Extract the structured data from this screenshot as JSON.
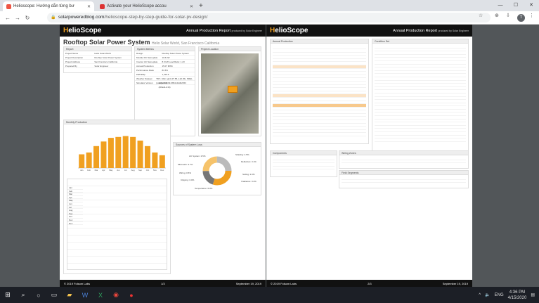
{
  "tabs": [
    {
      "title": "Helioscope: Hướng dẫn từng bư",
      "active": true
    },
    {
      "title": "Activate your HelioScope accou",
      "active": false
    }
  ],
  "address": {
    "domain": "solarpoweredblog.com",
    "path": "/helioscope-step-by-step-guide-for-solar-pv-design/"
  },
  "avatar": "T",
  "report": {
    "logo_a": "H",
    "logo_b": "elioScope",
    "title": "Annual Production Report",
    "subtitle": "produced by Solar Engineer",
    "main_title": "Rooftop Solar Power System",
    "location": "Helio Solar World, San Francisco California",
    "footer_left": "© 2019 Folsom Labs",
    "page1": "1/3",
    "page2": "2/3",
    "footer_date": "September 19, 2019",
    "sections": {
      "report": "Report",
      "metrics": "System Metrics",
      "location": "Project Location",
      "monthly": "Monthly Production",
      "sources": "Sources of System Loss",
      "annual": "Annual Production",
      "condition": "Condition Set",
      "components": "Components",
      "wiring": "Wiring Zones",
      "segments": "Field Segments"
    },
    "report_rows": [
      [
        "Project Name",
        "Hello Solar World"
      ],
      [
        "Project Description",
        "Rooftop Solar Power System"
      ],
      [
        "Project Address",
        "San Francisco California"
      ],
      [
        "Prepared By",
        "Solar Engineer"
      ]
    ],
    "metric_rows": [
      [
        "Design",
        "Rooftop Solar Power System"
      ],
      [
        "Module DC Nameplate",
        "10.6 kW"
      ],
      [
        "Inverter AC Nameplate",
        "8.6 kW Load Ratio: 1.23"
      ],
      [
        "Annual Production",
        "15.07 MWh"
      ],
      [
        "Performance Ratio",
        "81.5%"
      ],
      [
        "kWh/kWp",
        "1,419.6"
      ],
      [
        "Weather Dataset",
        "TMY, 10km grid (37.85,-122.45), NREL (prospector)"
      ],
      [
        "Simulator Version",
        "a57e0b9b09-9864c4ddb2b53 (t06a11-b16)"
      ]
    ],
    "months": [
      "Jan",
      "Feb",
      "Mar",
      "Apr",
      "May",
      "Jun",
      "Jul",
      "Aug",
      "Sep",
      "Oct",
      "Nov",
      "Dec"
    ],
    "loss_labels": [
      "AC System: 2.5%",
      "Shading: 4.5%",
      "Reflection: 3.1%",
      "Soiling: 2.0%",
      "Irradiance: 0.2%",
      "Mismatch: 3.7%",
      "Wiring: 0.5%",
      "Clipping: 0.0%",
      "Temperature: 6.0%"
    ]
  },
  "chart_data": {
    "type": "bar",
    "categories": [
      "Jan",
      "Feb",
      "Mar",
      "Apr",
      "May",
      "Jun",
      "Jul",
      "Aug",
      "Sep",
      "Oct",
      "Nov",
      "Dec"
    ],
    "values": [
      750,
      850,
      1200,
      1450,
      1650,
      1700,
      1750,
      1700,
      1500,
      1200,
      850,
      700
    ],
    "ylim": [
      0,
      2000
    ]
  },
  "taskbar": {
    "lang": "ENG",
    "time": "4:36 PM",
    "date": "4/15/2020"
  }
}
